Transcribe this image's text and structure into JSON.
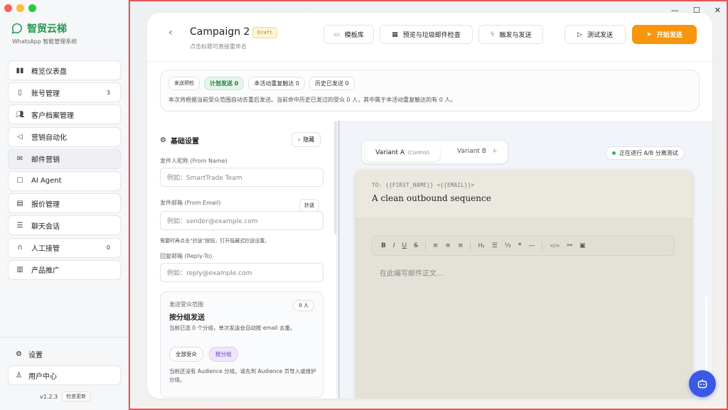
{
  "window": {
    "traffic_colors": [
      "#fe5f57",
      "#febc2e",
      "#28c840"
    ]
  },
  "brand": {
    "name": "智贸云梯",
    "subtitle": "WhatsApp 智能管理系统",
    "color": "#1f9a4b"
  },
  "nav": [
    {
      "label": "概览仪表盘",
      "icon": "chart-icon"
    },
    {
      "label": "账号管理",
      "icon": "phone-icon",
      "badge": "3"
    },
    {
      "label": "客户档案管理",
      "icon": "users-icon"
    },
    {
      "label": "营销自动化",
      "icon": "megaphone-icon"
    },
    {
      "label": "邮件营销",
      "icon": "mail-icon",
      "active": true
    },
    {
      "label": "AI Agent",
      "icon": "robot-icon"
    },
    {
      "label": "报价管理",
      "icon": "document-icon"
    },
    {
      "label": "聊天会话",
      "icon": "list-icon"
    },
    {
      "label": "人工接管",
      "icon": "headset-icon",
      "badge": "0"
    },
    {
      "label": "产品推广",
      "icon": "map-icon"
    }
  ],
  "settings_label": "设置",
  "user_center_label": "用户中心",
  "version": "v1.2.3",
  "check_update": "检查更新",
  "campaign": {
    "title": "Campaign 2",
    "status": "Draft",
    "hint": "点击标题可直接重命名"
  },
  "header_buttons": {
    "templates": "模板库",
    "preview_spam": "预览与垃圾邮件检查",
    "trigger_send": "触发与发送",
    "test_send": "测试发送",
    "start_send": "开始发送"
  },
  "accent": "#f7950e",
  "info": {
    "pills": [
      "发送预检",
      "计划发送 0",
      "本活动重复触达 0",
      "历史已发送 0"
    ],
    "text": "本次将根据当前受众范围自动去重后发送。当前命中历史已发过的受众 0 人，其中属于本活动重复触达的有 0 人。"
  },
  "basic": {
    "title": "基础设置",
    "hide": "隐藏",
    "from_name_label": "发件人昵称 (From Name)",
    "from_name_placeholder": "例如：SmartTrade Team",
    "from_email_label": "发件邮箱 (From Email)",
    "from_email_placeholder": "例如：sender@example.com",
    "cc_label": "抄送",
    "cc_note": "需要时再点击“抄送”按钮，打开隐藏式抄送设置。",
    "reply_to_label": "回复邮箱 (Reply-To)",
    "reply_to_placeholder": "例如：reply@example.com"
  },
  "audience": {
    "label": "发送受众范围",
    "count": "0 人",
    "title": "按分组发送",
    "desc": "当前已选 0 个分组，单次发送会自动按 email 去重。",
    "all_btn": "全部受众",
    "group_btn": "按分组",
    "note": "当前还没有 Audience 分组。请先到 Audience 页导入或维护分组。"
  },
  "variants": {
    "a": "Variant A",
    "a_tag": "(Control)",
    "b": "Variant B",
    "add": "+"
  },
  "ab_status": "正在进行 A/B 分离测试",
  "email": {
    "to": "TO: {{FIRST_NAME}} <{{EMAIL}}>",
    "subject": "A clean outbound sequence",
    "placeholder": "在此编写邮件正文..."
  },
  "toolbar": {
    "bold": "B",
    "italic": "I",
    "underline": "U",
    "strike": "S",
    "align_left": "≡",
    "align_center": "≡",
    "align_right": "≡",
    "h2": "H₂",
    "bullets": "☰",
    "numbered": "⅓",
    "quote": "❝",
    "rule": "—",
    "code": "</>",
    "link": "⚯",
    "image": "▣"
  }
}
